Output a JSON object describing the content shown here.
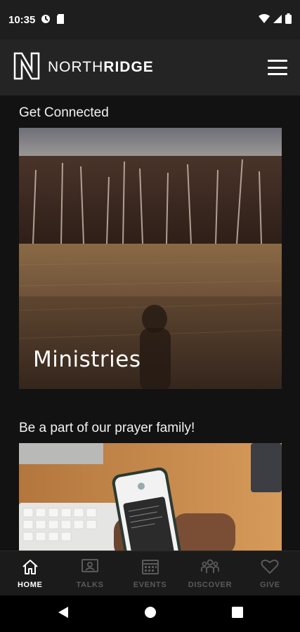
{
  "status": {
    "time": "10:35"
  },
  "header": {
    "brand_light": "NORTH",
    "brand_bold": "RIDGE"
  },
  "sections": [
    {
      "title": "Get Connected",
      "card_label": "Ministries"
    },
    {
      "title": "Be a part of our prayer family!"
    }
  ],
  "nav": {
    "items": [
      {
        "label": "HOME",
        "icon": "home-icon",
        "active": true
      },
      {
        "label": "TALKS",
        "icon": "talks-icon",
        "active": false
      },
      {
        "label": "EVENTS",
        "icon": "calendar-icon",
        "active": false
      },
      {
        "label": "DISCOVER",
        "icon": "people-icon",
        "active": false
      },
      {
        "label": "GIVE",
        "icon": "heart-icon",
        "active": false
      }
    ]
  },
  "colors": {
    "active": "#ffffff",
    "inactive": "#5a5a5a",
    "header_bg": "#242424"
  }
}
